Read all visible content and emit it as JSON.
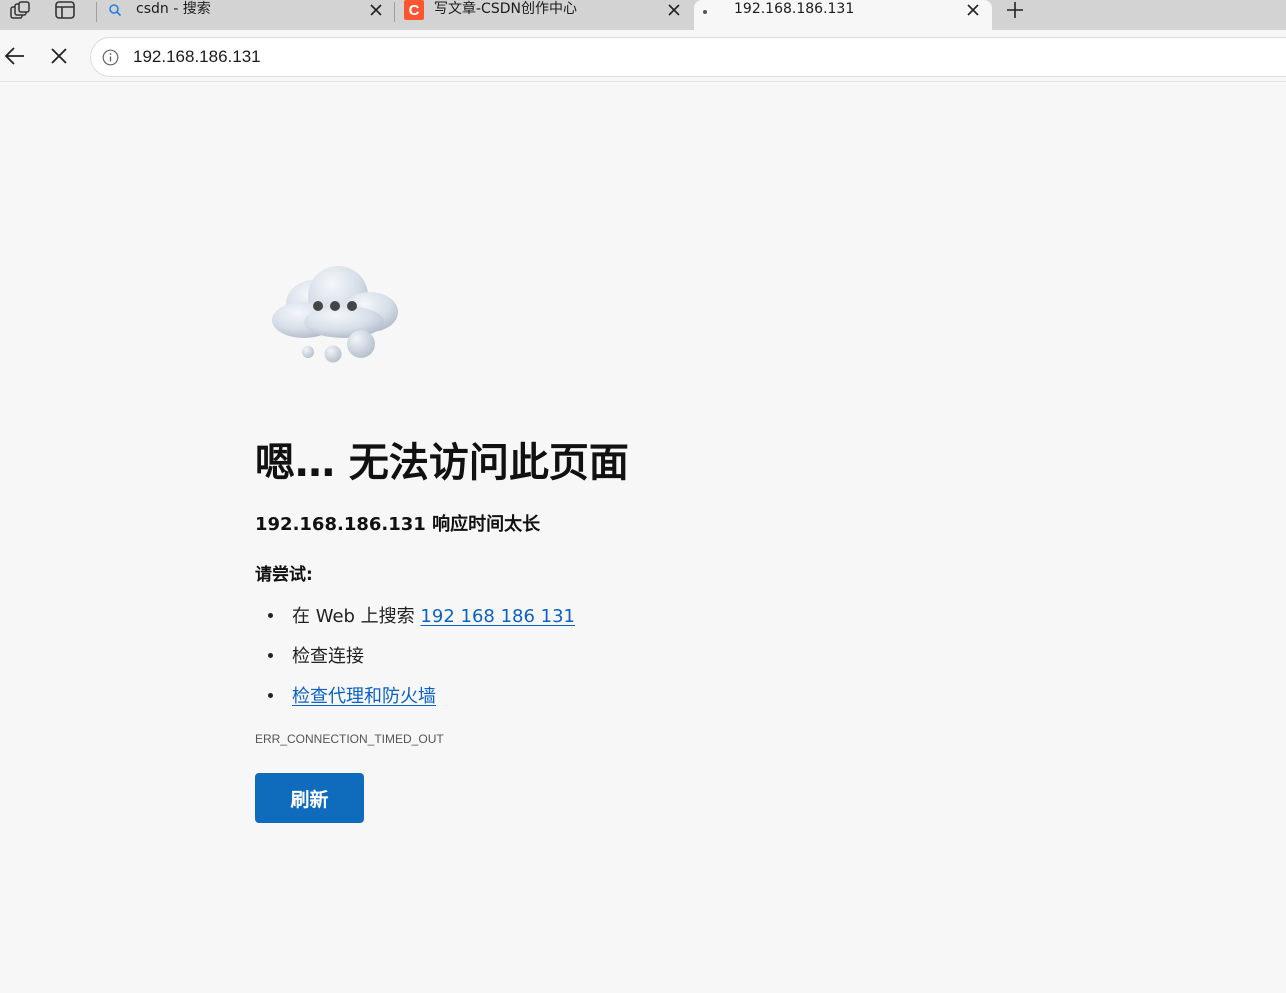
{
  "browser": {
    "tabs": [
      {
        "title": "csdn - 搜索",
        "icon": "search-icon"
      },
      {
        "title": "写文章-CSDN创作中心",
        "icon": "csdn-logo-icon"
      },
      {
        "title": "192.168.186.131",
        "icon": "loading-dot-icon"
      }
    ],
    "address": "192.168.186.131",
    "accent": "#0f6cbd",
    "csdn_brand_color": "#fc5531"
  },
  "error": {
    "heading": "嗯… 无法访问此页面",
    "subtitle": "192.168.186.131 响应时间太长",
    "try_label": "请尝试:",
    "suggestion1_prefix": "在 Web 上搜索 ",
    "suggestion1_link": "192 168 186 131",
    "suggestion2": "检查连接",
    "suggestion3_link": "检查代理和防火墙",
    "code": "ERR_CONNECTION_TIMED_OUT",
    "refresh_label": "刷新"
  }
}
